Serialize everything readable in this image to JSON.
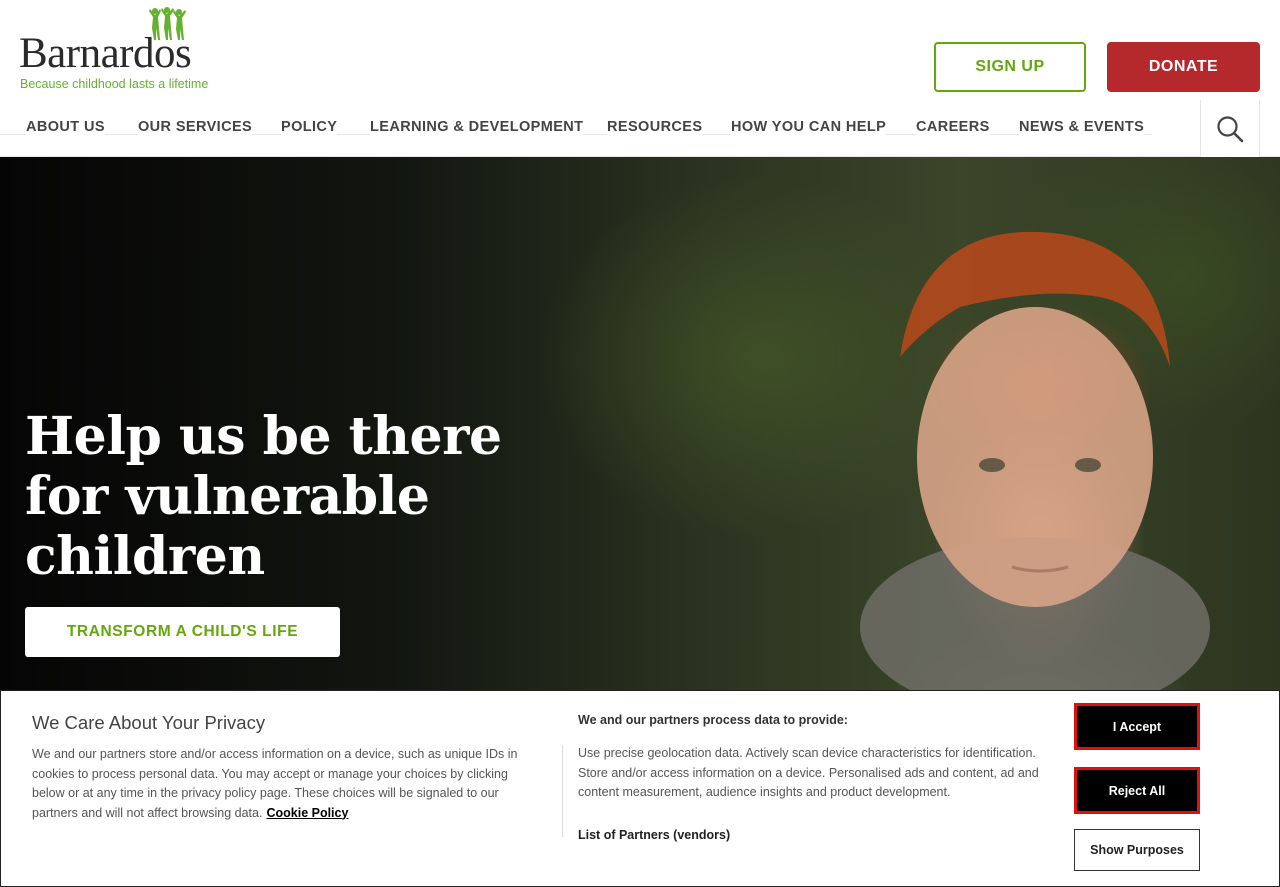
{
  "header": {
    "logo_text": "Barnardos",
    "tagline": "Because childhood lasts a lifetime",
    "signup_label": "SIGN UP",
    "donate_label": "DONATE",
    "brand_green": "#64a70b",
    "donate_red": "#b5292d"
  },
  "nav": {
    "items": [
      {
        "label": "ABOUT US"
      },
      {
        "label": "OUR SERVICES"
      },
      {
        "label": "POLICY"
      },
      {
        "label": "LEARNING & DEVELOPMENT"
      },
      {
        "label": "RESOURCES"
      },
      {
        "label": "HOW YOU CAN HELP"
      },
      {
        "label": "CAREERS"
      },
      {
        "label": "NEWS & EVENTS"
      }
    ],
    "search_icon": "search-icon"
  },
  "hero": {
    "line1": "Help us be there",
    "line2": "for vulnerable",
    "line3": "children",
    "cta_label": "TRANSFORM A CHILD'S LIFE"
  },
  "cookie": {
    "title": "We Care About Your Privacy",
    "body": "We and our partners store and/or access information on a device, such as unique IDs in cookies to process personal data. You may accept or manage your choices by clicking below or at any time in the privacy policy page. These choices will be signaled to our partners and will not affect browsing data.",
    "policy_link": "Cookie Policy",
    "purposes_heading": "We and our partners process data to provide:",
    "purposes_text": "Use precise geolocation data. Actively scan device characteristics for identification. Store and/or access information on a device. Personalised ads and content, ad and content measurement, audience insights and product development.",
    "partners_link": "List of Partners (vendors)",
    "accept_label": "I Accept",
    "reject_label": "Reject All",
    "show_label": "Show Purposes"
  }
}
